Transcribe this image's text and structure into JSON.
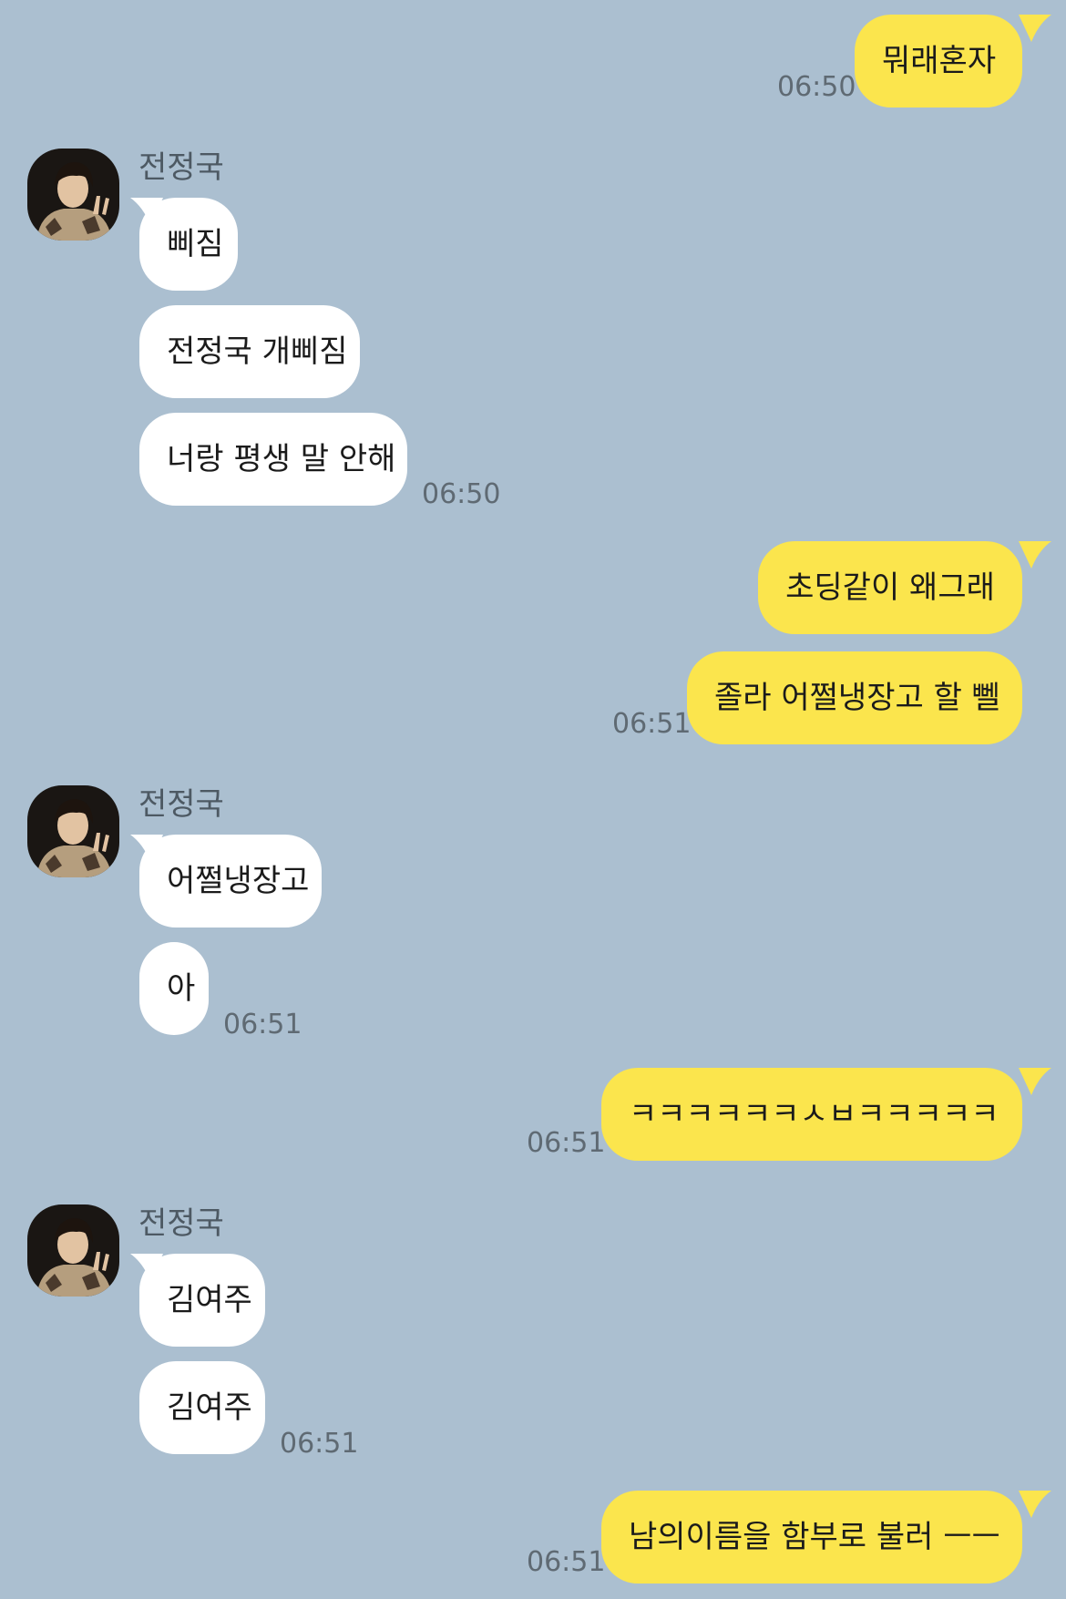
{
  "contact": {
    "name": "전정국"
  },
  "colors": {
    "background": "#abbfd0",
    "my_bubble": "#fbe54d",
    "their_bubble": "#ffffff"
  },
  "messages": [
    {
      "sender": "me",
      "text": "뭐래혼자",
      "time": "06:50"
    },
    {
      "sender": "them",
      "text": "삐짐"
    },
    {
      "sender": "them",
      "text": "전정국 개삐짐"
    },
    {
      "sender": "them",
      "text": "너랑 평생 말 안해",
      "time": "06:50"
    },
    {
      "sender": "me",
      "text": "초딩같이 왜그래"
    },
    {
      "sender": "me",
      "text": "졸라 어쩔냉장고 할 뻴",
      "time": "06:51"
    },
    {
      "sender": "them",
      "text": "어쩔냉장고"
    },
    {
      "sender": "them",
      "text": "아",
      "time": "06:51"
    },
    {
      "sender": "me",
      "text": "ㅋㅋㅋㅋㅋㅋㅅㅂㅋㅋㅋㅋㅋ",
      "time": "06:51"
    },
    {
      "sender": "them",
      "text": "김여주"
    },
    {
      "sender": "them",
      "text": "김여주",
      "time": "06:51"
    },
    {
      "sender": "me",
      "text": "남의이름을 함부로 불러 ㅡㅡ",
      "time": "06:51"
    }
  ]
}
